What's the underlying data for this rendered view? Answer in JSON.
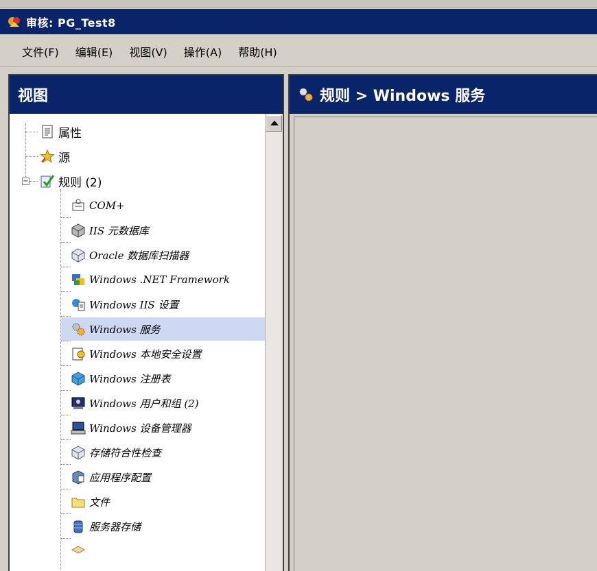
{
  "window": {
    "title": "审核: PG_Test8"
  },
  "menu": [
    "文件(F)",
    "编辑(E)",
    "视图(V)",
    "操作(A)",
    "帮助(H)"
  ],
  "left_pane": {
    "title": "视图"
  },
  "right_pane": {
    "breadcrumb": "规则 > Windows 服务"
  },
  "tree": {
    "roots": [
      {
        "label": "属性",
        "icon": "document-icon"
      },
      {
        "label": "源",
        "icon": "star-icon"
      },
      {
        "label": "规则 (2)",
        "icon": "rules-check-icon",
        "expanded": true
      }
    ],
    "rules_children": [
      {
        "label": "COM+",
        "icon": "com-icon"
      },
      {
        "label": "IIS 元数据库",
        "icon": "iis-metabase-icon"
      },
      {
        "label": "Oracle 数据库扫描器",
        "icon": "oracle-cube-icon"
      },
      {
        "label": "Windows .NET Framework",
        "icon": "dotnet-icon"
      },
      {
        "label": "Windows IIS 设置",
        "icon": "iis-settings-icon"
      },
      {
        "label": "Windows 服务",
        "icon": "gears-icon",
        "selected": true
      },
      {
        "label": "Windows 本地安全设置",
        "icon": "security-icon"
      },
      {
        "label": "Windows 注册表",
        "icon": "registry-icon"
      },
      {
        "label": "Windows 用户和组 (2)",
        "icon": "users-groups-icon"
      },
      {
        "label": "Windows 设备管理器",
        "icon": "device-manager-icon"
      },
      {
        "label": "存储符合性检查",
        "icon": "storage-cube-icon"
      },
      {
        "label": "应用程序配置",
        "icon": "app-config-icon"
      },
      {
        "label": "文件",
        "icon": "folder-icon"
      },
      {
        "label": "服务器存储",
        "icon": "server-storage-icon"
      }
    ]
  },
  "colors": {
    "title_bar": "#0a246a",
    "selection": "#cdd8f3",
    "chrome": "#d4d0c8"
  }
}
